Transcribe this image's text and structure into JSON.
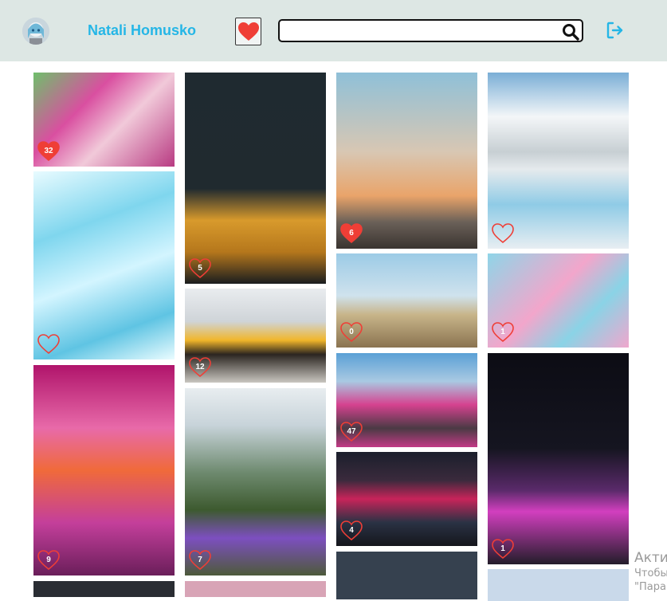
{
  "header": {
    "username": "Natali Homusko",
    "search_placeholder": "",
    "icons": {
      "avatar": "avatar-image",
      "favorites": "heart-icon",
      "search": "search-icon",
      "logout": "logout-icon"
    },
    "colors": {
      "background": "#dde7e4",
      "accent": "#25b6e6",
      "heart": "#ef3e36"
    }
  },
  "photos": [
    {
      "name": "photo-runners-pink",
      "likes": "32",
      "liked": true,
      "bg": "linear-gradient(135deg,#6fbf6b 0%,#d94fa0 35%,#f1c9d9 60%,#b83a82 100%)"
    },
    {
      "name": "photo-blue-leaves",
      "likes": "",
      "liked": false,
      "bg": "linear-gradient(160deg,#e8fbff 0%,#7fd6ee 30%,#d3f5ff 55%,#5fc4e3 80%,#eafcff 100%)"
    },
    {
      "name": "photo-pink-forest",
      "likes": "9",
      "liked": false,
      "bg": "linear-gradient(180deg,#b0146b 0%,#e86aa9 30%,#f06a3a 50%,#c43f9b 75%,#6a1e5a 100%)"
    },
    {
      "name": "photo-dark-restaurant",
      "likes": "5",
      "liked": false,
      "bg": "linear-gradient(180deg,#1f2a30 0%,#202a2f 55%,#d89a2c 70%,#b5771c 85%,#1a1d1f 100%)"
    },
    {
      "name": "photo-two-athletes",
      "likes": "12",
      "liked": false,
      "bg": "linear-gradient(180deg,#e9ecef 0%,#cfd4d8 35%,#f1b62a 55%,#2b2520 70%,#c9c6c0 100%)"
    },
    {
      "name": "photo-mountain-flowers",
      "likes": "7",
      "liked": false,
      "bg": "linear-gradient(180deg,#e8edf0 0%,#c7d3d9 20%,#6e8a6f 45%,#3d5a2f 65%,#7d4fc0 80%,#4d5a3a 100%)"
    },
    {
      "name": "photo-girl-rooftop",
      "likes": "6",
      "liked": true,
      "bg": "linear-gradient(180deg,#8fc0d8 0%,#d8c7b3 45%,#e9a46a 70%,#6a6058 85%,#3a3430 100%)"
    },
    {
      "name": "photo-girl-field",
      "likes": "0",
      "liked": false,
      "bg": "linear-gradient(180deg,#9ccbe6 0%,#cfe2ed 45%,#c8b58a 65%,#8a7350 100%)"
    },
    {
      "name": "photo-pink-crowd",
      "likes": "47",
      "liked": false,
      "bg": "linear-gradient(180deg,#5aa0d6 0%,#a9c9e2 30%,#d5428f 55%,#4a3a44 80%,#c23a86 100%)"
    },
    {
      "name": "photo-neon-street",
      "likes": "4",
      "liked": false,
      "bg": "linear-gradient(180deg,#1b1f2c 0%,#3a2a3c 30%,#c8245a 50%,#2a3244 75%,#15161c 100%)"
    },
    {
      "name": "photo-salt-pools",
      "likes": "",
      "liked": false,
      "bg": "linear-gradient(180deg,#7aaed6 0%,#f3f6f8 25%,#c7cfd3 45%,#e5eaed 55%,#8fcbe6 75%,#e8eef2 100%)"
    },
    {
      "name": "photo-ribbon-art",
      "likes": "1",
      "liked": false,
      "bg": "linear-gradient(135deg,#8fd5e8 0%,#f2a6cb 45%,#8ad3e6 70%,#f0a7cd 100%)"
    },
    {
      "name": "photo-tokyo-tower",
      "likes": "1",
      "liked": false,
      "bg": "linear-gradient(180deg,#0c0c14 0%,#151520 45%,#5a2a6a 65%,#d23fbf 75%,#231d2a 100%)"
    },
    {
      "name": "photo-partial-dark",
      "likes": "",
      "liked": false,
      "bg": "#2a2d33"
    },
    {
      "name": "photo-partial-pink",
      "likes": "",
      "liked": false,
      "bg": "#d8a4b6"
    },
    {
      "name": "photo-partial-stars",
      "likes": "",
      "liked": false,
      "bg": "#36414f"
    },
    {
      "name": "photo-partial-sky",
      "likes": "",
      "liked": false,
      "bg": "#c9d9ea"
    }
  ],
  "watermark": {
    "line1": "Акти",
    "line2": "Чтобы",
    "line3": "\"Пара"
  }
}
